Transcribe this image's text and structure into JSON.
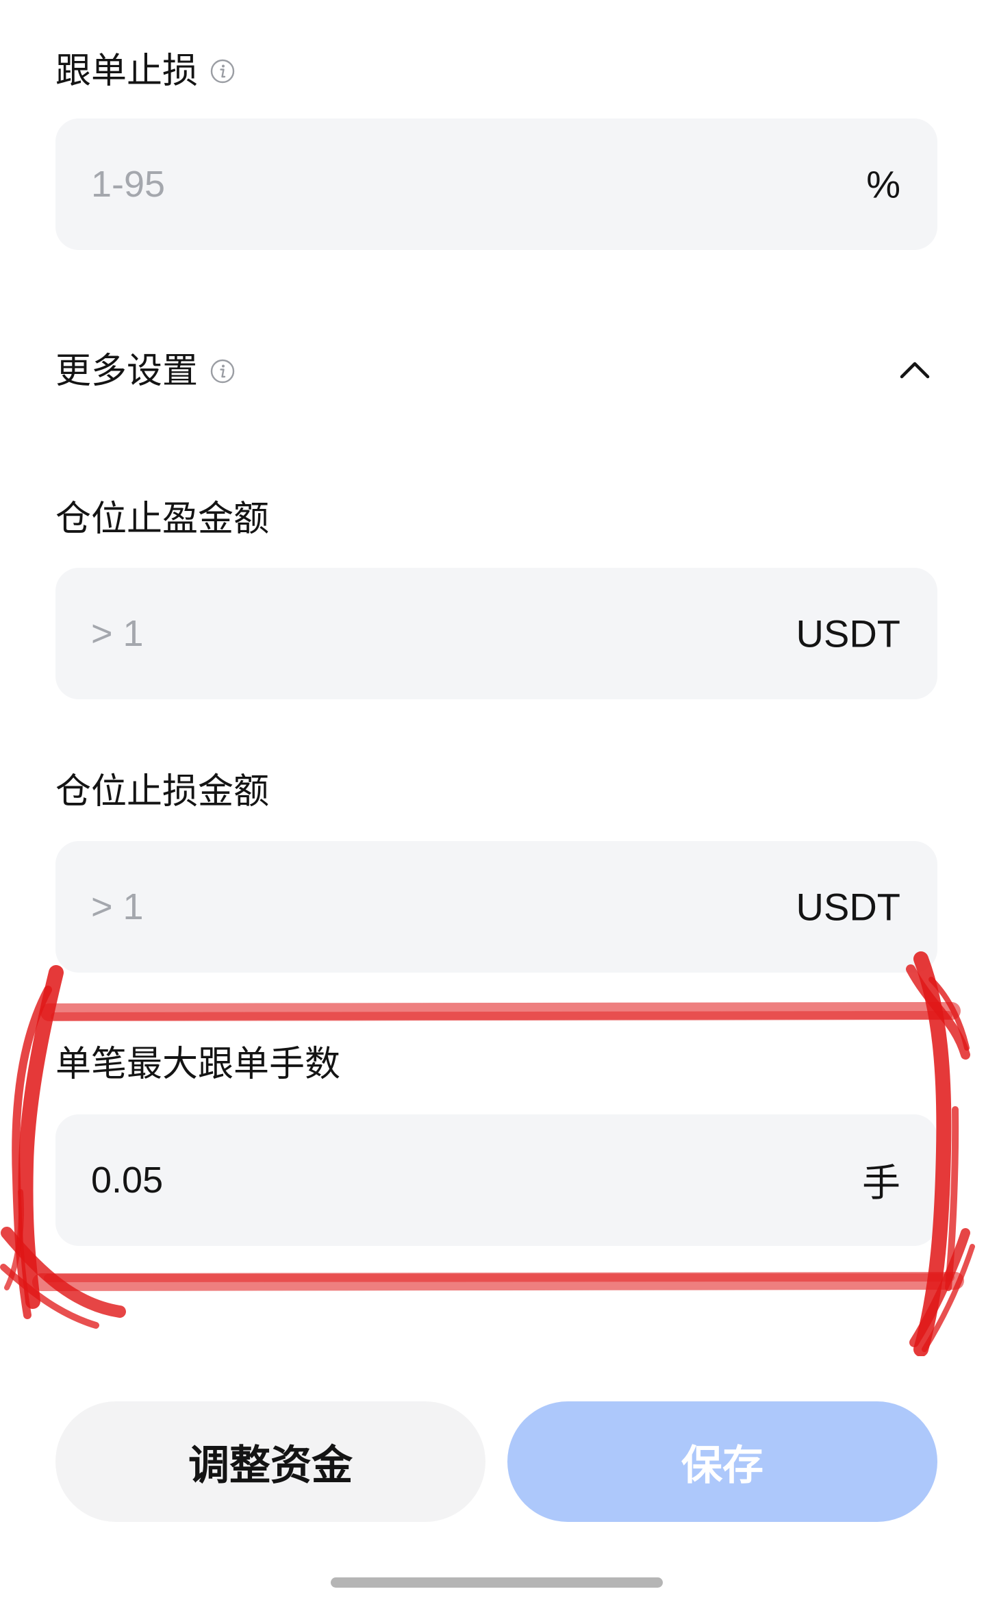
{
  "stop_loss": {
    "label": "跟单止损",
    "placeholder": "1-95",
    "unit": "%"
  },
  "more_settings": {
    "label": "更多设置",
    "expanded": true
  },
  "take_profit_amount": {
    "label": "仓位止盈金额",
    "placeholder": "> 1",
    "unit": "USDT"
  },
  "stop_loss_amount": {
    "label": "仓位止损金额",
    "placeholder": "> 1",
    "unit": "USDT"
  },
  "max_lots": {
    "label": "单笔最大跟单手数",
    "value": "0.05",
    "unit": "手"
  },
  "buttons": {
    "adjust_funds": "调整资金",
    "save": "保存"
  },
  "colors": {
    "field_bg": "#f4f5f7",
    "save_button_bg": "#adc8fb",
    "annotation": "#e01616"
  },
  "icons": {
    "info": "info-icon",
    "collapse": "chevron-up-icon"
  }
}
